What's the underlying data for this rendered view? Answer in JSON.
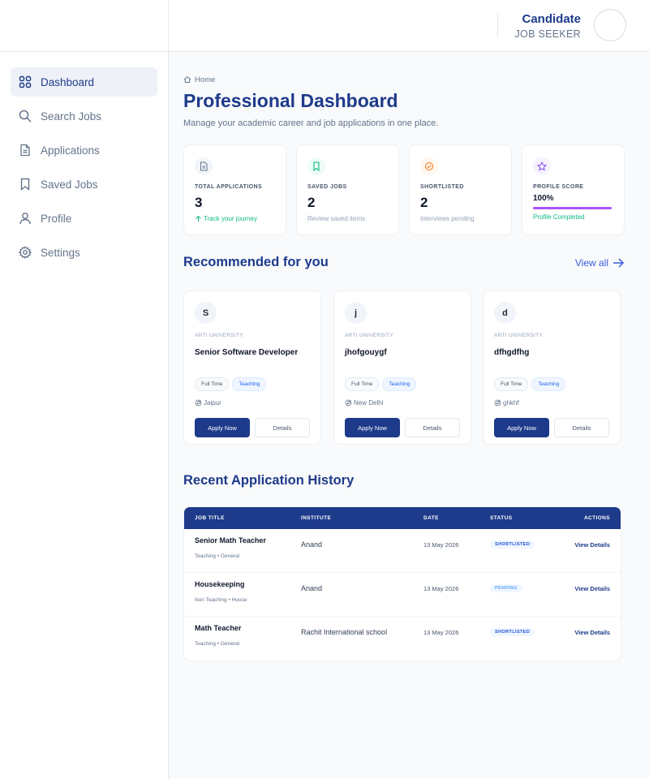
{
  "user": {
    "name": "Candidate",
    "role": "JOB SEEKER"
  },
  "sidebar": {
    "items": [
      {
        "label": "Dashboard",
        "icon": "dashboard-icon",
        "active": true
      },
      {
        "label": "Search Jobs",
        "icon": "search-icon"
      },
      {
        "label": "Applications",
        "icon": "document-icon"
      },
      {
        "label": "Saved Jobs",
        "icon": "bookmark-icon"
      },
      {
        "label": "Profile",
        "icon": "user-icon"
      },
      {
        "label": "Settings",
        "icon": "gear-icon"
      }
    ]
  },
  "header": {
    "breadcrumb": "Home",
    "title": "Professional Dashboard",
    "subtitle": "Manage your academic career and job applications in one place."
  },
  "stats": [
    {
      "label": "TOTAL APPLICATIONS",
      "value": "3",
      "note": "Track your journey",
      "icon": "file-icon",
      "color": "#64748b"
    },
    {
      "label": "SAVED JOBS",
      "value": "2",
      "note": "Review saved items",
      "icon": "bookmark-icon",
      "color": "#10b981"
    },
    {
      "label": "SHORTLISTED",
      "value": "2",
      "note": "Interviews pending",
      "icon": "check-circle-icon",
      "color": "#f97316"
    },
    {
      "label": "PROFILE SCORE",
      "value": "100%",
      "note": "Profile Completed",
      "icon": "star-icon",
      "color": "#7c3aed",
      "progress": 1.0
    }
  ],
  "recommended": {
    "title": "Recommended for you",
    "view_all": "View all",
    "jobs": [
      {
        "initial": "S",
        "institute": "ARTI UNIVERSITY",
        "title": "Senior Software Developer",
        "tags": [
          "Full Time",
          "Teaching"
        ],
        "location": "Jaipur",
        "apply": "Apply Now",
        "details": "Details"
      },
      {
        "initial": "j",
        "institute": "ARTI UNIVERSITY",
        "title": "jhofgouygf",
        "tags": [
          "Full Time",
          "Teaching"
        ],
        "location": "New Delhi",
        "apply": "Apply Now",
        "details": "Details"
      },
      {
        "initial": "d",
        "institute": "ARTI UNIVERSITY",
        "title": "dfhgdfhg",
        "tags": [
          "Full Time",
          "Teaching"
        ],
        "location": "ghkhf",
        "apply": "Apply Now",
        "details": "Details"
      }
    ]
  },
  "history": {
    "title": "Recent Application History",
    "columns": [
      "JOB TITLE",
      "INSTITUTE",
      "DATE",
      "STATUS",
      "ACTIONS"
    ],
    "rows": [
      {
        "title": "Senior Math Teacher",
        "sub": "Teaching • General",
        "institute": "Anand",
        "date": "13 May 2026",
        "status": "SHORTLISTED",
        "action": "View Details"
      },
      {
        "title": "Housekeeping",
        "sub": "Non Teaching • House",
        "institute": "Anand",
        "date": "13 May 2026",
        "status": "PENDING",
        "action": "View Details"
      },
      {
        "title": "Math Teacher",
        "sub": "Teaching • General",
        "institute": "Rachit International school",
        "date": "13 May 2026",
        "status": "SHORTLISTED",
        "action": "View Details"
      }
    ]
  }
}
